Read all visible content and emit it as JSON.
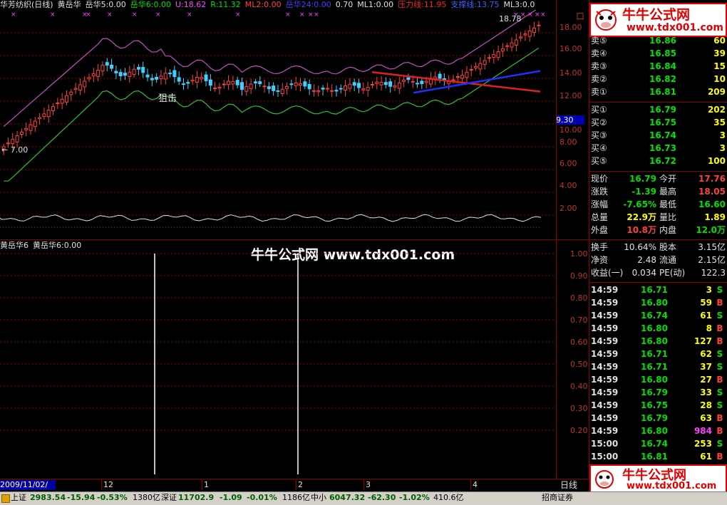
{
  "main_header": {
    "items": [
      {
        "text": "华芳纺织(日线)",
        "color": "#e0e0e0"
      },
      {
        "text": "黄岳华",
        "color": "#e0e0e0"
      },
      {
        "text": "岳华5:0.00",
        "color": "#e0e0e0"
      },
      {
        "text": "岳华6:0.00",
        "color": "#00e000"
      },
      {
        "text": "U:18.62",
        "color": "#ff40ff"
      },
      {
        "text": "R:11.32",
        "color": "#00e000"
      },
      {
        "text": "ML2:0.00",
        "color": "#ff4040"
      },
      {
        "text": "岳华24:0.00",
        "color": "#4040ff"
      },
      {
        "text": "0.70",
        "color": "#e0e0e0"
      },
      {
        "text": "ML1:0.00",
        "color": "#e0e0e0"
      },
      {
        "text": "压力线:11.95",
        "color": "#ff2020"
      },
      {
        "text": "支撑线:13.75",
        "color": "#4060ff"
      },
      {
        "text": "ML3:0.0",
        "color": "#e0e0e0"
      }
    ]
  },
  "sub_header": {
    "items": [
      {
        "text": "黄岳华6",
        "color": "#e0e0e0"
      },
      {
        "text": "黄岳华6:0.00",
        "color": "#e0e0e0"
      }
    ]
  },
  "price_axis": [
    "18.00",
    "16.00",
    "14.00",
    "12.00",
    "10.00",
    "9.30",
    "8.00",
    "6.00",
    "4.00",
    "2.00"
  ],
  "sub_axis": [
    "1.00",
    "0.90",
    "0.80",
    "0.70",
    "0.60",
    "0.50",
    "0.40",
    "0.30",
    "0.20"
  ],
  "chart_annotations": {
    "low_mark": "← 7.00",
    "high_mark": "18.78",
    "signal_text": "狙击",
    "watermark": "牛牛公式网 www.tdx001.com",
    "x_marks": "×",
    "cap_label": "口"
  },
  "date_axis": {
    "current_date": "2009/11/02/一",
    "ticks": [
      "12",
      "1",
      "2",
      "3",
      "4"
    ],
    "period": "日线"
  },
  "logo": {
    "title": "牛牛公式网",
    "url": "www.tdx001.com"
  },
  "order_book": {
    "asks": [
      {
        "label": "卖⑤",
        "price": "16.86",
        "vol": "60"
      },
      {
        "label": "卖④",
        "price": "16.85",
        "vol": "39"
      },
      {
        "label": "卖③",
        "price": "16.84",
        "vol": "15"
      },
      {
        "label": "卖②",
        "price": "16.82",
        "vol": "10"
      },
      {
        "label": "卖①",
        "price": "16.81",
        "vol": "209"
      }
    ],
    "bids": [
      {
        "label": "买①",
        "price": "16.79",
        "vol": "202"
      },
      {
        "label": "买②",
        "price": "16.75",
        "vol": "35"
      },
      {
        "label": "买③",
        "price": "16.74",
        "vol": "3"
      },
      {
        "label": "买④",
        "price": "16.73",
        "vol": "3"
      },
      {
        "label": "买⑤",
        "price": "16.72",
        "vol": "100"
      }
    ]
  },
  "quote": {
    "rows": [
      {
        "l1": "现价",
        "v1": "16.79",
        "c1": "#00e000",
        "l2": "今开",
        "v2": "17.76",
        "c2": "#ff4040"
      },
      {
        "l1": "涨跌",
        "v1": "-1.39",
        "c1": "#00e000",
        "l2": "最高",
        "v2": "18.05",
        "c2": "#ff4040"
      },
      {
        "l1": "涨幅",
        "v1": "-7.65%",
        "c1": "#00e000",
        "l2": "最低",
        "v2": "16.60",
        "c2": "#00e000"
      },
      {
        "l1": "总量",
        "v1": "22.9万",
        "c1": "#ffff00",
        "l2": "量比",
        "v2": "1.89",
        "c2": "#ffff00"
      },
      {
        "l1": "外盘",
        "v1": "10.8万",
        "c1": "#ff4040",
        "l2": "内盘",
        "v2": "12.0万",
        "c2": "#00e000"
      }
    ],
    "rows2": [
      {
        "l1": "换手",
        "v1": "10.64%",
        "l2": "股本",
        "v2": "3.15亿"
      },
      {
        "l1": "净资",
        "v1": "2.48",
        "l2": "流通",
        "v2": "2.15亿"
      },
      {
        "l1": "收益(一)",
        "v1": "0.034",
        "l2": "PE(动)",
        "v2": "122.3"
      }
    ]
  },
  "ticks": [
    {
      "time": "14:59",
      "price": "16.71",
      "pc": "#00e000",
      "vol": "3",
      "vc": "#ffff00",
      "side": "S",
      "sc": "#00e000"
    },
    {
      "time": "14:59",
      "price": "16.80",
      "pc": "#00e000",
      "vol": "59",
      "vc": "#ffff00",
      "side": "B",
      "sc": "#ff4040"
    },
    {
      "time": "14:59",
      "price": "16.74",
      "pc": "#00e000",
      "vol": "61",
      "vc": "#ffff00",
      "side": "S",
      "sc": "#00e000"
    },
    {
      "time": "14:59",
      "price": "16.80",
      "pc": "#00e000",
      "vol": "8",
      "vc": "#ffff00",
      "side": "B",
      "sc": "#ff4040"
    },
    {
      "time": "14:59",
      "price": "16.80",
      "pc": "#00e000",
      "vol": "127",
      "vc": "#ffff00",
      "side": "B",
      "sc": "#ff4040"
    },
    {
      "time": "14:59",
      "price": "16.71",
      "pc": "#00e000",
      "vol": "62",
      "vc": "#ffff00",
      "side": "S",
      "sc": "#00e000"
    },
    {
      "time": "14:59",
      "price": "16.71",
      "pc": "#00e000",
      "vol": "37",
      "vc": "#ffff00",
      "side": "S",
      "sc": "#00e000"
    },
    {
      "time": "14:59",
      "price": "16.80",
      "pc": "#00e000",
      "vol": "27",
      "vc": "#ffff00",
      "side": "B",
      "sc": "#ff4040"
    },
    {
      "time": "14:59",
      "price": "16.79",
      "pc": "#00e000",
      "vol": "33",
      "vc": "#ffff00",
      "side": "S",
      "sc": "#00e000"
    },
    {
      "time": "14:59",
      "price": "16.75",
      "pc": "#00e000",
      "vol": "28",
      "vc": "#ffff00",
      "side": "S",
      "sc": "#00e000"
    },
    {
      "time": "14:59",
      "price": "16.79",
      "pc": "#00e000",
      "vol": "63",
      "vc": "#ffff00",
      "side": "B",
      "sc": "#ff4040"
    },
    {
      "time": "14:59",
      "price": "16.80",
      "pc": "#00e000",
      "vol": "984",
      "vc": "#ff40ff",
      "side": "B",
      "sc": "#ff4040"
    },
    {
      "time": "15:00",
      "price": "16.74",
      "pc": "#00e000",
      "vol": "253",
      "vc": "#ffff00",
      "side": "S",
      "sc": "#00e000"
    },
    {
      "time": "15:00",
      "price": "16.81",
      "pc": "#00e000",
      "vol": "61",
      "vc": "#ffff00",
      "side": "B",
      "sc": "#ff4040"
    }
  ],
  "status_bar": {
    "sh_label": "上证",
    "sh_val": "2983.54",
    "sh_chg": "-15.94",
    "sh_pct": "-0.53%",
    "sh_amt": "1380亿",
    "sz_label": "深证",
    "sz_val": "11702.9",
    "sz_chg": "-1.09",
    "sz_pct": "-0.01%",
    "sz_amt": "1186亿",
    "zx_label": "中小",
    "zx_val": "6047.32",
    "zx_chg": "-62.30",
    "zx_pct": "-1.02%",
    "zx_amt": "410.6亿",
    "broker": "招商证券"
  },
  "colors": {
    "bg": "#000000",
    "panel_border": "#8b0000",
    "up": "#ff4040",
    "down": "#00e000",
    "ma_upper": "#c050c0",
    "ma_lower": "#30c030",
    "support": "#2030ff",
    "resistance": "#e02020"
  }
}
